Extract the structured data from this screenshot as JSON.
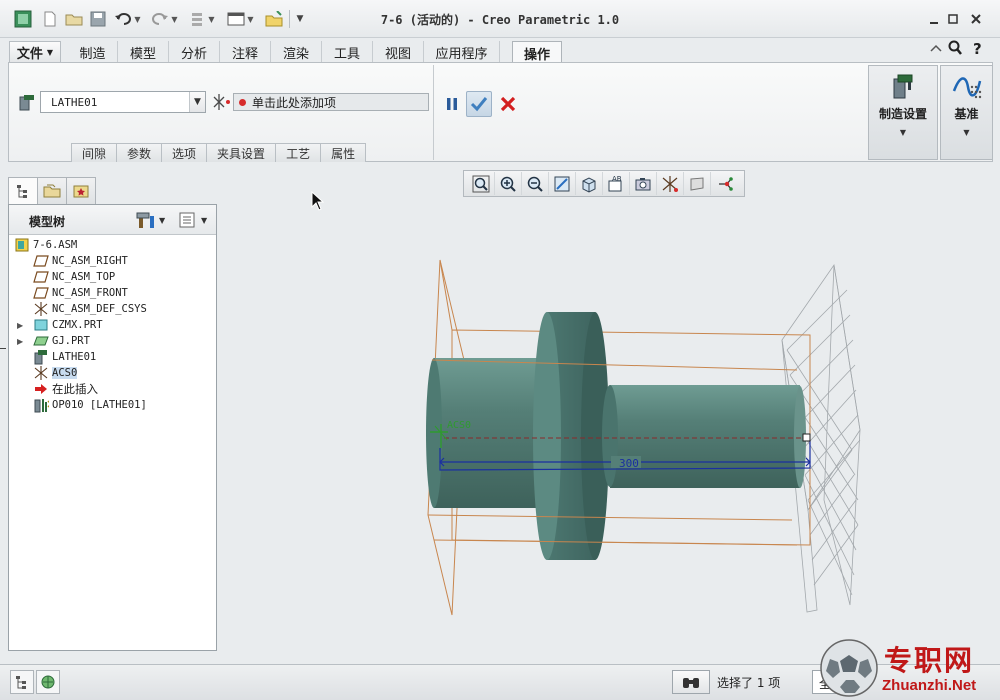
{
  "window": {
    "title": "7-6 (活动的) - Creo Parametric 1.0"
  },
  "ribbon_tabs": [
    {
      "label": "文件"
    },
    {
      "label": "制造"
    },
    {
      "label": "模型"
    },
    {
      "label": "分析"
    },
    {
      "label": "注释"
    },
    {
      "label": "渲染"
    },
    {
      "label": "工具"
    },
    {
      "label": "视图"
    },
    {
      "label": "应用程序"
    },
    {
      "label": "操作"
    }
  ],
  "dashboard": {
    "workcenter_value": "LATHE01",
    "collector_placeholder": "单击此处添加项",
    "subtabs": [
      "间隙",
      "参数",
      "选项",
      "夹具设置",
      "工艺",
      "属性"
    ]
  },
  "ribbon_groups": {
    "mfg_setup_label": "制造设置",
    "datum_label": "基准"
  },
  "navigator": {
    "title": "模型树",
    "tree": [
      {
        "label": "7-6.ASM",
        "icon": "assembly-icon",
        "indent": 0
      },
      {
        "label": "NC_ASM_RIGHT",
        "icon": "datum-plane-icon",
        "indent": 1
      },
      {
        "label": "NC_ASM_TOP",
        "icon": "datum-plane-icon",
        "indent": 1
      },
      {
        "label": "NC_ASM_FRONT",
        "icon": "datum-plane-icon",
        "indent": 1
      },
      {
        "label": "NC_ASM_DEF_CSYS",
        "icon": "csys-icon",
        "indent": 1
      },
      {
        "label": "CZMX.PRT",
        "icon": "part-icon",
        "indent": 1,
        "expandable": true
      },
      {
        "label": "GJ.PRT",
        "icon": "workpiece-icon",
        "indent": 1,
        "expandable": true
      },
      {
        "label": "LATHE01",
        "icon": "lathe-icon",
        "indent": 1
      },
      {
        "label": "ACS0",
        "icon": "csys-icon",
        "indent": 1,
        "selected": true
      },
      {
        "label": "在此插入",
        "icon": "insert-arrow-icon",
        "indent": 1
      },
      {
        "label": "OP010 [LATHE01]",
        "icon": "operation-icon",
        "indent": 1
      }
    ]
  },
  "viewport": {
    "csys_label": "ACS0",
    "dimension_value": "300"
  },
  "status": {
    "selection_text": "选择了 1 项",
    "filter_value": "全"
  },
  "watermark": {
    "cn": "专职网",
    "en": "Zhuanzhi.Net"
  },
  "colors": {
    "part_teal": "#4f7f76",
    "datum_orange": "#c8864e",
    "cancel_red": "#d31f1f",
    "ok_blue": "#3f7fbf"
  }
}
